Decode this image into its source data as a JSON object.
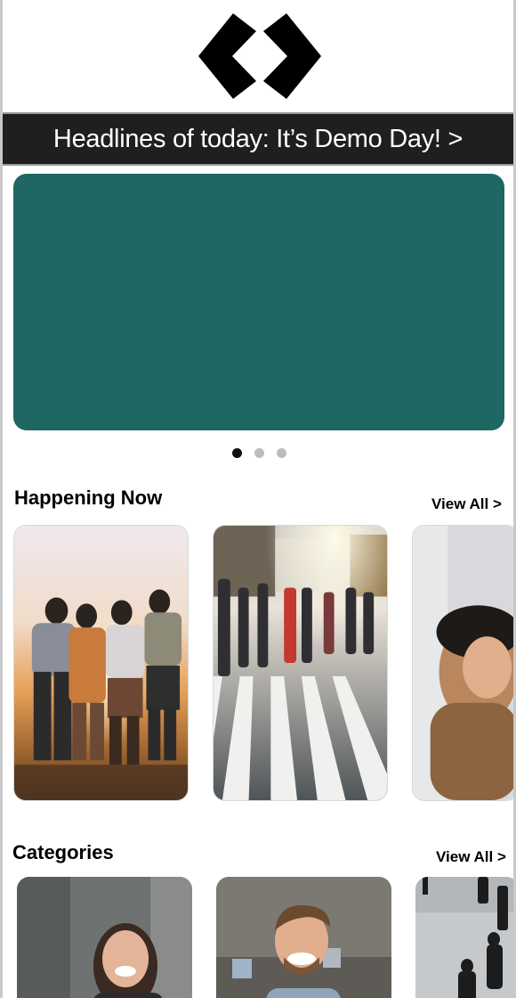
{
  "logo": {
    "icon": "diamond-chevrons-logo",
    "color": "#000000"
  },
  "banner": {
    "headline": "Headlines of today: It’s Demo Day! >"
  },
  "hero": {
    "color": "#1e6762"
  },
  "carousel": {
    "dots": [
      {
        "active": true
      },
      {
        "active": false
      },
      {
        "active": false
      }
    ]
  },
  "happening_now": {
    "title": "Happening Now",
    "view_all": "View All >",
    "cards": [
      {
        "image": "friends-sunset-photo"
      },
      {
        "image": "crosswalk-crowd-photo"
      },
      {
        "image": "woman-hat-photo"
      }
    ]
  },
  "categories": {
    "title": "Categories",
    "view_all": "View All >",
    "cards": [
      {
        "image": "smiling-woman-photo"
      },
      {
        "image": "smiling-man-photo"
      },
      {
        "image": "busy-street-photo"
      }
    ]
  }
}
